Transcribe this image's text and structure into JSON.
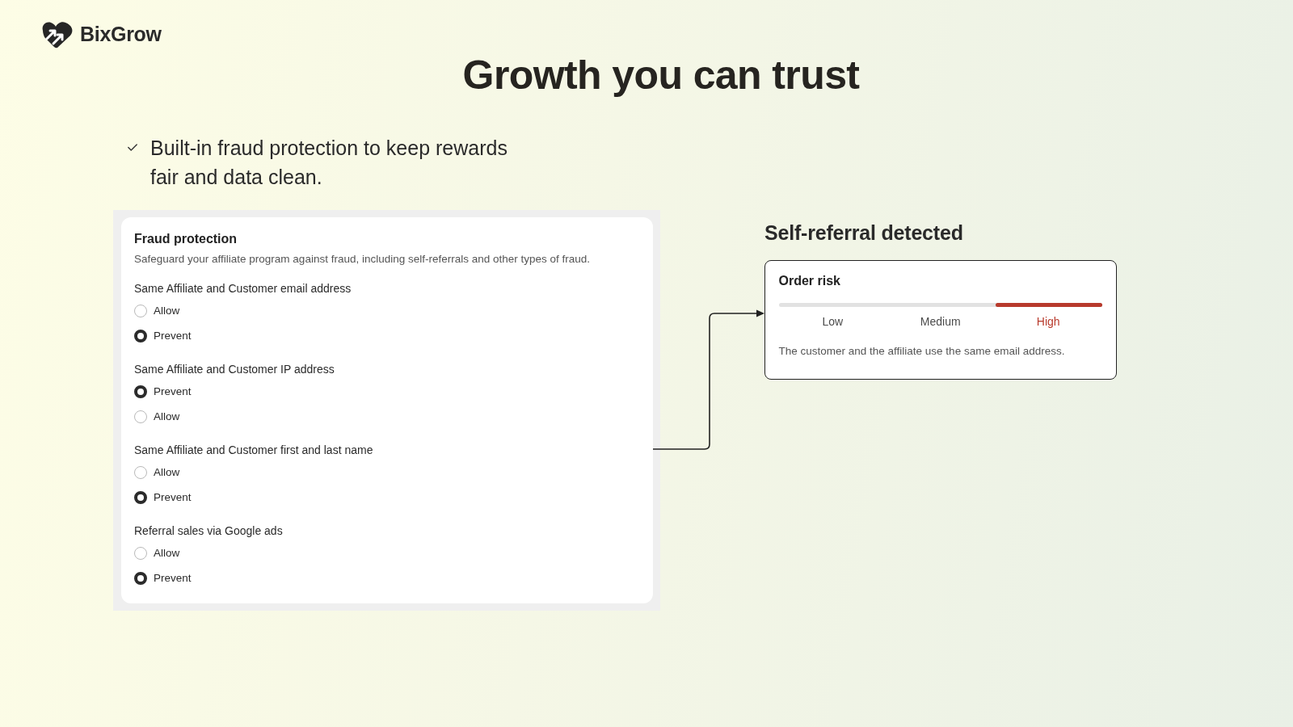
{
  "brand": {
    "name": "BixGrow"
  },
  "headline": "Growth you can trust",
  "features": [
    {
      "text": "Built-in fraud protection to keep rewards fair and data clean."
    }
  ],
  "fraud_protection": {
    "title": "Fraud protection",
    "description": "Safeguard your affiliate program against fraud, including self-referrals and other types of fraud.",
    "settings": [
      {
        "label": "Same Affiliate and Customer email address",
        "options": [
          {
            "label": "Allow",
            "selected": false
          },
          {
            "label": "Prevent",
            "selected": true
          }
        ]
      },
      {
        "label": "Same Affiliate and Customer IP address",
        "options": [
          {
            "label": "Prevent",
            "selected": true
          },
          {
            "label": "Allow",
            "selected": false
          }
        ]
      },
      {
        "label": "Same Affiliate and Customer first and last name",
        "options": [
          {
            "label": "Allow",
            "selected": false
          },
          {
            "label": "Prevent",
            "selected": true
          }
        ]
      },
      {
        "label": "Referral sales via Google ads",
        "options": [
          {
            "label": "Allow",
            "selected": false
          },
          {
            "label": "Prevent",
            "selected": true
          }
        ]
      }
    ]
  },
  "alert": {
    "heading": "Self-referral detected",
    "card": {
      "title": "Order risk",
      "level": 0.33,
      "levels": [
        {
          "label": "Low",
          "selected": false
        },
        {
          "label": "Medium",
          "selected": false
        },
        {
          "label": "High",
          "selected": true
        }
      ],
      "message": "The customer and the affiliate use the same email address."
    }
  }
}
